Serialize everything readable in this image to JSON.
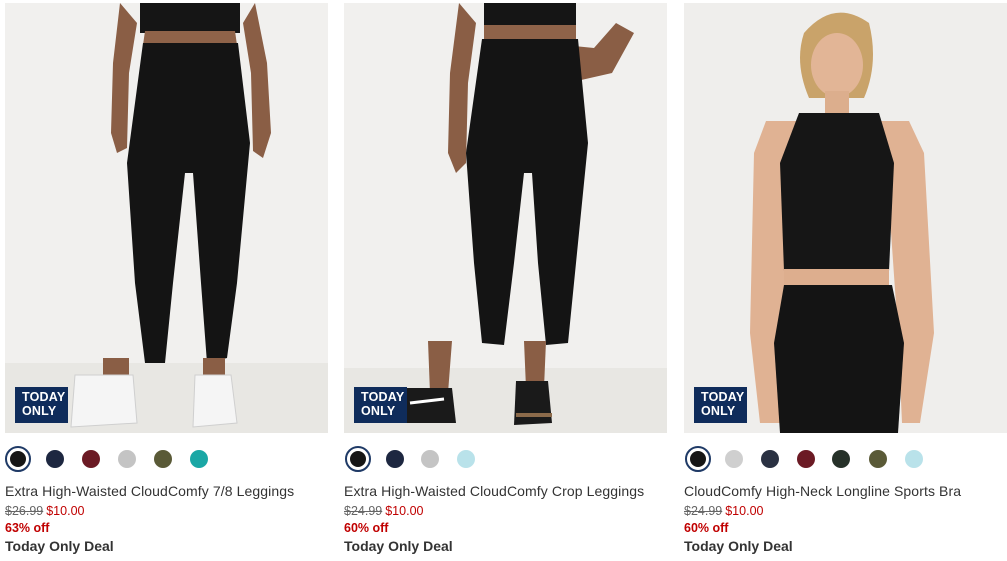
{
  "products": [
    {
      "badge_line1": "TODAY",
      "badge_line2": "ONLY",
      "name": "Extra High-Waisted CloudComfy 7/8 Leggings",
      "old_price": "$26.99",
      "new_price": "$10.00",
      "discount": "63% off",
      "deal": "Today Only Deal",
      "swatches": [
        "#161616",
        "#1d2740",
        "#6b1a24",
        "#c4c4c4",
        "#5a5a37",
        "#1aa7a5"
      ]
    },
    {
      "badge_line1": "TODAY",
      "badge_line2": "ONLY",
      "name": "Extra High-Waisted CloudComfy Crop Leggings",
      "old_price": "$24.99",
      "new_price": "$10.00",
      "discount": "60% off",
      "deal": "Today Only Deal",
      "swatches": [
        "#161616",
        "#1d2740",
        "#c4c4c4",
        "#b9e2ea"
      ]
    },
    {
      "badge_line1": "TODAY",
      "badge_line2": "ONLY",
      "name": "CloudComfy High-Neck Longline Sports Bra",
      "old_price": "$24.99",
      "new_price": "$10.00",
      "discount": "60% off",
      "deal": "Today Only Deal",
      "swatches": [
        "#161616",
        "#cfcfcf",
        "#2a3142",
        "#6b1a24",
        "#263129",
        "#5a5a37",
        "#b9e2ea"
      ]
    }
  ],
  "colors": {
    "badge_bg": "#0f2c5b",
    "sale_red": "#c00000",
    "selected_ring": "#1f3a66"
  }
}
